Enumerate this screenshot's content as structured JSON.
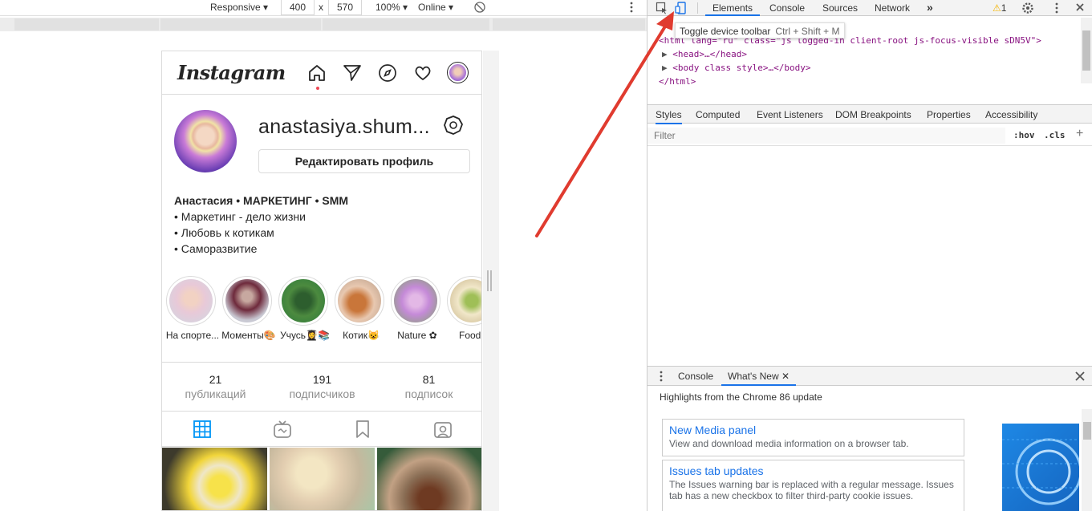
{
  "device_toolbar": {
    "device": "Responsive",
    "width": "400",
    "times": "x",
    "height": "570",
    "zoom": "100%",
    "throttle": "Online"
  },
  "instagram": {
    "logo": "Instagram",
    "username": "anastasiya.shum...",
    "edit_profile": "Редактировать профиль",
    "bio": {
      "name": "Анастасия • МАРКЕТИНГ • SMM",
      "lines": [
        "• Маркетинг - дело жизни",
        "• Любовь к котикам",
        "• Саморазвитие"
      ]
    },
    "stories": [
      {
        "label": "На спорте..."
      },
      {
        "label": "Моменты🎨"
      },
      {
        "label": "Учусь👩‍🎓📚"
      },
      {
        "label": "Котик😺"
      },
      {
        "label": "Nature ✿"
      },
      {
        "label": "FoodD"
      }
    ],
    "stats": [
      {
        "num": "21",
        "label": "публикаций"
      },
      {
        "num": "191",
        "label": "подписчиков"
      },
      {
        "num": "81",
        "label": "подписок"
      }
    ]
  },
  "devtools": {
    "tabs": [
      "Elements",
      "Console",
      "Sources",
      "Network"
    ],
    "more": "»",
    "warning_count": "1",
    "tooltip": {
      "label": "Toggle device toolbar",
      "shortcut": "Ctrl + Shift + M"
    },
    "dom": {
      "html_line": "<html lang=\"ru\" class=\"js logged-in client-root js-focus-visible sDN5V\">",
      "head_line": "<head>…</head>",
      "body_line": "<body class style>…</body>",
      "close_line": "</html>"
    },
    "sub_tabs": [
      "Styles",
      "Computed",
      "Event Listeners",
      "DOM Breakpoints",
      "Properties",
      "Accessibility"
    ],
    "filter_placeholder": "Filter",
    "hov": ":hov",
    "cls": ".cls",
    "plus": "+",
    "drawer": {
      "tabs": [
        "Console",
        "What's New"
      ],
      "title": "Highlights from the Chrome 86 update",
      "cards": [
        {
          "title": "New Media panel",
          "desc": "View and download media information on a browser tab."
        },
        {
          "title": "Issues tab updates",
          "desc": "The Issues warning bar is replaced with a regular message. Issues tab has a new checkbox to filter third-party cookie issues."
        }
      ]
    }
  },
  "colors": {
    "accent": "#1a73e8",
    "arrow": "#e03b2f",
    "ig_red": "#ed4956"
  }
}
